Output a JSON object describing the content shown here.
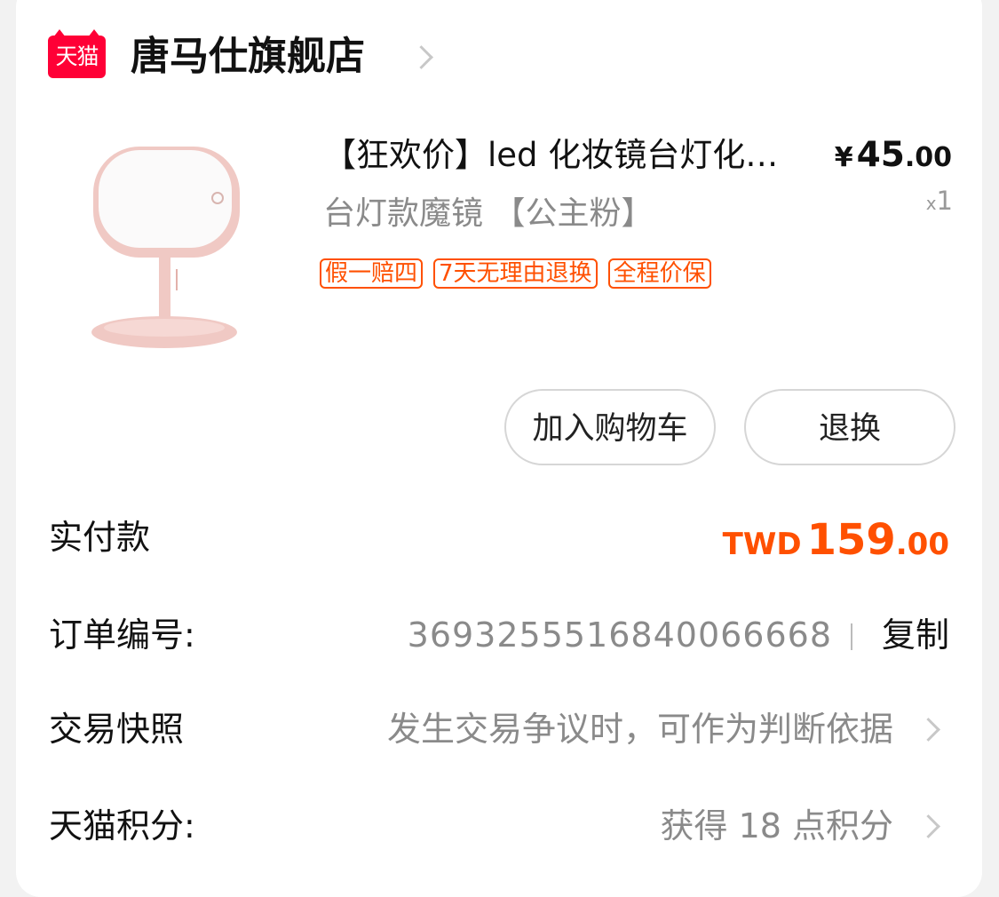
{
  "store": {
    "logo_text": "天猫",
    "name": "唐马仕旗舰店"
  },
  "product": {
    "image_icon": "pink-led-vanity-mirror-lamp",
    "title": "【狂欢价】led 化妆镜台灯化妆镜台灯化妆镜",
    "price_symbol": "¥",
    "price_int": "45",
    "price_cents": ".00",
    "sku": "台灯款魔镜 【公主粉】",
    "qty_prefix": "x",
    "qty": "1",
    "tags": [
      "假一赔四",
      "7天无理由退换",
      "全程价保"
    ],
    "tag_color": "#ff5000"
  },
  "actions": {
    "add_to_cart": "加入购物车",
    "return_exchange": "退换"
  },
  "payment": {
    "label": "实付款",
    "currency": "TWD",
    "amount_int": "159",
    "amount_cents": ".00",
    "color": "#ff5000"
  },
  "order": {
    "label": "订单编号:",
    "number": "3693255516840066668",
    "copy_label": "复制"
  },
  "snapshot": {
    "label": "交易快照",
    "value": "发生交易争议时，可作为判断依据"
  },
  "points": {
    "label": "天猫积分:",
    "value": "获得 18 点积分"
  }
}
